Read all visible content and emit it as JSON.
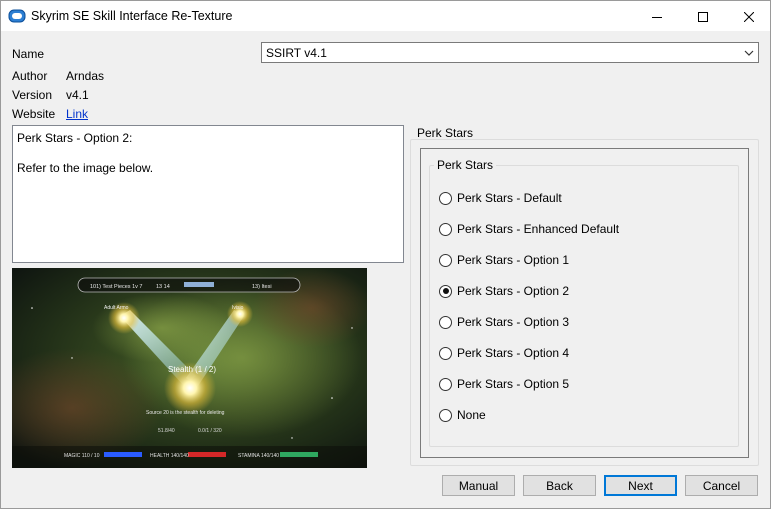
{
  "window": {
    "title": "Skyrim SE Skill Interface Re-Texture",
    "icon": "mod-manager-icon"
  },
  "info": {
    "name_label": "Name",
    "name_value": "SSIRT v4.1",
    "author_label": "Author",
    "author_value": "Arndas",
    "version_label": "Version",
    "version_value": "v4.1",
    "website_label": "Website",
    "website_link": "Link"
  },
  "description": {
    "line1": "Perk Stars - Option 2:",
    "line2": "Refer to the image below."
  },
  "preview": {
    "top_left": "101) Test Pieces 1v 7",
    "top_mid": "13 14",
    "top_right": "13) Itesi",
    "left_perk": "Adult Armo",
    "right_perk": "Ivisio",
    "center_title": "Stealth (1 / 2)",
    "center_desc": "Source 20 is the stealth for deleting",
    "stat_left": "51.8/40",
    "stat_right": "0.0/1 / 320",
    "bar1_label": "MAGIC 110 / 10",
    "bar2_label": "HEALTH 140/140",
    "bar3_label": "STAMINA 140/140"
  },
  "group": {
    "outer_label": "Perk Stars",
    "inner_label": "Perk Stars",
    "options": [
      {
        "label": "Perk Stars - Default",
        "checked": false
      },
      {
        "label": "Perk Stars - Enhanced Default",
        "checked": false
      },
      {
        "label": "Perk Stars - Option 1",
        "checked": false
      },
      {
        "label": "Perk Stars - Option 2",
        "checked": true
      },
      {
        "label": "Perk Stars - Option 3",
        "checked": false
      },
      {
        "label": "Perk Stars - Option 4",
        "checked": false
      },
      {
        "label": "Perk Stars - Option 5",
        "checked": false
      },
      {
        "label": "None",
        "checked": false
      }
    ]
  },
  "buttons": {
    "manual": "Manual",
    "back": "Back",
    "next": "Next",
    "cancel": "Cancel"
  },
  "colors": {
    "link": "#0033cc",
    "accent": "#0078d7",
    "magicka_bar": "#2a5cff",
    "health_bar": "#d42828",
    "stamina_bar": "#2fa860"
  }
}
